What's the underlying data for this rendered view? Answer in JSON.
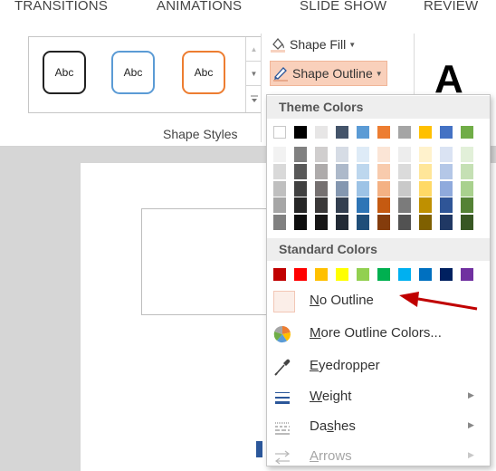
{
  "tabs": [
    "TRANSITIONS",
    "ANIMATIONS",
    "SLIDE SHOW",
    "REVIEW"
  ],
  "shape_styles": {
    "thumbnails": [
      "Abc",
      "Abc",
      "Abc"
    ],
    "group_label": "Shape Styles"
  },
  "commands": {
    "shape_fill": "Shape Fill",
    "shape_outline": "Shape Outline",
    "wordart_letter": "A"
  },
  "dropdown": {
    "theme_colors_header": "Theme Colors",
    "standard_colors_header": "Standard Colors",
    "theme_colors": [
      [
        "#ffffff",
        "#f2f2f2",
        "#d9d9d9",
        "#bfbfbf",
        "#a6a6a6",
        "#808080"
      ],
      [
        "#000000",
        "#808080",
        "#595959",
        "#404040",
        "#262626",
        "#0d0d0d"
      ],
      [
        "#e7e6e6",
        "#d0cece",
        "#aeabab",
        "#757070",
        "#3a3838",
        "#171616"
      ],
      [
        "#44546a",
        "#d6dce5",
        "#adb9ca",
        "#8497b0",
        "#333f50",
        "#222a35"
      ],
      [
        "#5b9bd5",
        "#deebf7",
        "#bdd7ee",
        "#9dc3e6",
        "#2e75b6",
        "#1f4e79"
      ],
      [
        "#ed7d31",
        "#fbe5d6",
        "#f8cbad",
        "#f4b183",
        "#c55a11",
        "#843c0c"
      ],
      [
        "#a5a5a5",
        "#ededed",
        "#dbdbdb",
        "#c9c9c9",
        "#7b7b7b",
        "#525252"
      ],
      [
        "#ffc000",
        "#fff2cc",
        "#ffe699",
        "#ffd966",
        "#bf9000",
        "#7f6000"
      ],
      [
        "#4472c4",
        "#dae3f3",
        "#b4c7e7",
        "#8faadc",
        "#2f5597",
        "#203864"
      ],
      [
        "#70ad47",
        "#e2f0d9",
        "#c5e0b4",
        "#a9d18e",
        "#548235",
        "#385723"
      ]
    ],
    "standard_colors": [
      "#c00000",
      "#ff0000",
      "#ffc000",
      "#ffff00",
      "#92d050",
      "#00b050",
      "#00b0f0",
      "#0070c0",
      "#002060",
      "#7030a0"
    ],
    "items": {
      "no_outline": {
        "pre": "",
        "key": "N",
        "post": "o Outline"
      },
      "more_colors": {
        "pre": "",
        "key": "M",
        "post": "ore Outline Colors..."
      },
      "eyedropper": {
        "pre": "",
        "key": "E",
        "post": "yedropper"
      },
      "weight": {
        "pre": "",
        "key": "W",
        "post": "eight"
      },
      "dashes": {
        "pre": "Da",
        "key": "s",
        "post": "hes"
      },
      "arrows": {
        "pre": "",
        "key": "A",
        "post": "rrows"
      }
    }
  }
}
